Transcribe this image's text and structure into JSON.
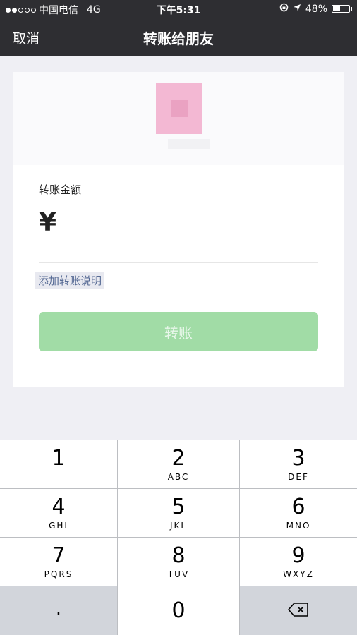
{
  "status_bar": {
    "carrier": "中国电信",
    "network": "4G",
    "time": "下午5:31",
    "battery": "48%",
    "battery_level": 0.48,
    "signal_bars_filled": 2,
    "signal_bars_total": 5
  },
  "nav": {
    "cancel_label": "取消",
    "title": "转账给朋友"
  },
  "form": {
    "amount_label": "转账金额",
    "currency_symbol": "¥",
    "amount_value": "",
    "add_note_label": "添加转账说明",
    "transfer_button_label": "转账"
  },
  "keypad": {
    "keys": [
      {
        "digit": "1",
        "letters": ""
      },
      {
        "digit": "2",
        "letters": "ABC"
      },
      {
        "digit": "3",
        "letters": "DEF"
      },
      {
        "digit": "4",
        "letters": "GHI"
      },
      {
        "digit": "5",
        "letters": "JKL"
      },
      {
        "digit": "6",
        "letters": "MNO"
      },
      {
        "digit": "7",
        "letters": "PQRS"
      },
      {
        "digit": "8",
        "letters": "TUV"
      },
      {
        "digit": "9",
        "letters": "WXYZ"
      }
    ],
    "decimal_label": ".",
    "zero_label": "0"
  },
  "colors": {
    "nav_bg": "#2e2e32",
    "accent_green": "#a1dca6",
    "link_blue": "#576b95"
  }
}
